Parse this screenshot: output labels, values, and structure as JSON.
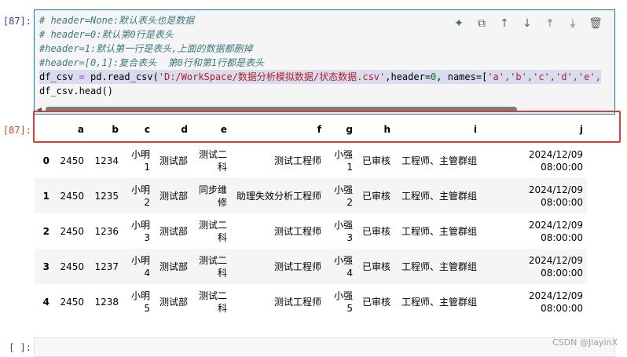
{
  "cells": {
    "input_prompt": "[87]:",
    "output_prompt": "[87]:",
    "empty_prompt": "[ ]:"
  },
  "code": {
    "line1": "# header=None:默认表头也是数据",
    "line2": "# header=0:默认第0行是表头",
    "line3": "#header=1:默认第一行是表头,上面的数据都删掉",
    "line4": "#header=[0,1]:复合表头  第0行和第1行都是表头",
    "line5": {
      "var": "df_csv",
      "eq": " = ",
      "func": "pd.read_csv(",
      "path": "'D:/WorkSpace/数据分析模拟数据/状态数据.csv'",
      "mid": ",header=",
      "header_val": "0",
      "names_kw": ", names=[",
      "names": "'a','b','c','d','e',"
    },
    "line6": "df_csv.head()"
  },
  "toolbar": {
    "icons": [
      "sparkle-icon",
      "copy-icon",
      "arrow-up-icon",
      "arrow-down-icon",
      "insert-above-icon",
      "insert-below-icon",
      "trash-icon"
    ]
  },
  "table": {
    "columns": [
      "a",
      "b",
      "c",
      "d",
      "e",
      "f",
      "g",
      "h",
      "i",
      "j"
    ],
    "rows": [
      {
        "index": "0",
        "cells": [
          "2450",
          "1234",
          "小明1",
          "测试部",
          "测试二科",
          "测试工程师",
          "小强1",
          "已审核",
          "工程师、主管群组",
          "2024/12/09 08:00:00"
        ]
      },
      {
        "index": "1",
        "cells": [
          "2450",
          "1235",
          "小明2",
          "测试部",
          "同步维修",
          "助理失效分析工程师",
          "小强2",
          "已审核",
          "工程师、主管群组",
          "2024/12/09 08:00:00"
        ]
      },
      {
        "index": "2",
        "cells": [
          "2450",
          "1236",
          "小明3",
          "测试部",
          "测试二科",
          "测试工程师",
          "小强3",
          "已审核",
          "工程师、主管群组",
          "2024/12/09 08:00:00"
        ]
      },
      {
        "index": "3",
        "cells": [
          "2450",
          "1237",
          "小明4",
          "测试部",
          "测试二科",
          "测试工程师",
          "小强4",
          "已审核",
          "工程师、主管群组",
          "2024/12/09 08:00:00"
        ]
      },
      {
        "index": "4",
        "cells": [
          "2450",
          "1238",
          "小明5",
          "测试部",
          "测试二科",
          "测试工程师",
          "小强5",
          "已审核",
          "工程师、主管群组",
          "2024/12/09 08:00:00"
        ]
      }
    ]
  },
  "watermark": "CSDN @JiayinX"
}
